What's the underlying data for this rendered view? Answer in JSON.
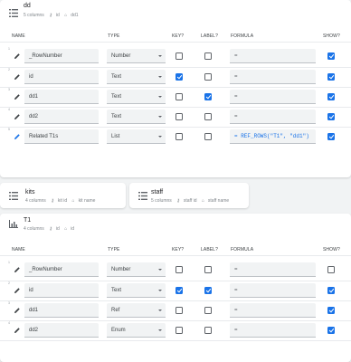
{
  "columns": {
    "name": "NAME",
    "type": "TYPE",
    "key": "KEY?",
    "label": "LABEL?",
    "formula": "FORMULA",
    "show": "SHOW?"
  },
  "dd": {
    "title": "dd",
    "meta_count": "5 columns",
    "meta_id": "id",
    "meta_label": "dd1",
    "rows": [
      {
        "num": "1",
        "name": "_RowNumber",
        "type": "Number",
        "key": false,
        "label": false,
        "formula": "=",
        "show": true
      },
      {
        "num": "2",
        "name": "id",
        "type": "Text",
        "key": true,
        "label": false,
        "formula": "=",
        "show": true
      },
      {
        "num": "3",
        "name": "dd1",
        "type": "Text",
        "key": false,
        "label": true,
        "formula": "=",
        "show": true
      },
      {
        "num": "4",
        "name": "dd2",
        "type": "Text",
        "key": false,
        "label": false,
        "formula": "=",
        "show": true
      },
      {
        "num": "5",
        "name": "Related T1s",
        "type": "List",
        "key": false,
        "label": false,
        "formula": "= REF_ROWS(\"T1\", \"dd1\")",
        "show": true
      }
    ]
  },
  "kits": {
    "title": "kits",
    "meta_count": "4 columns",
    "meta_id": "kit id",
    "meta_label": "kit name"
  },
  "staff": {
    "title": "staff",
    "meta_count": "5 columns",
    "meta_id": "staff id",
    "meta_label": "staff name"
  },
  "t1": {
    "title": "T1",
    "meta_count": "4 columns",
    "meta_id": "id",
    "meta_label": "id",
    "rows": [
      {
        "num": "1",
        "name": "_RowNumber",
        "type": "Number",
        "key": false,
        "label": false,
        "formula": "=",
        "show": false
      },
      {
        "num": "2",
        "name": "id",
        "type": "Text",
        "key": true,
        "label": true,
        "formula": "=",
        "show": true
      },
      {
        "num": "3",
        "name": "dd1",
        "type": "Ref",
        "key": false,
        "label": false,
        "formula": "=",
        "show": true
      },
      {
        "num": "4",
        "name": "dd2",
        "type": "Enum",
        "key": false,
        "label": false,
        "formula": "=",
        "show": true
      }
    ]
  },
  "icons": {
    "table": "table-list-icon",
    "chart": "bar-chart-icon",
    "key": "key-icon",
    "label": "tag-icon",
    "edit": "pencil-icon"
  },
  "colors": {
    "accent": "#1a73e8",
    "page_bg": "#f1f3f4",
    "input_bg": "#f1f3f4"
  }
}
